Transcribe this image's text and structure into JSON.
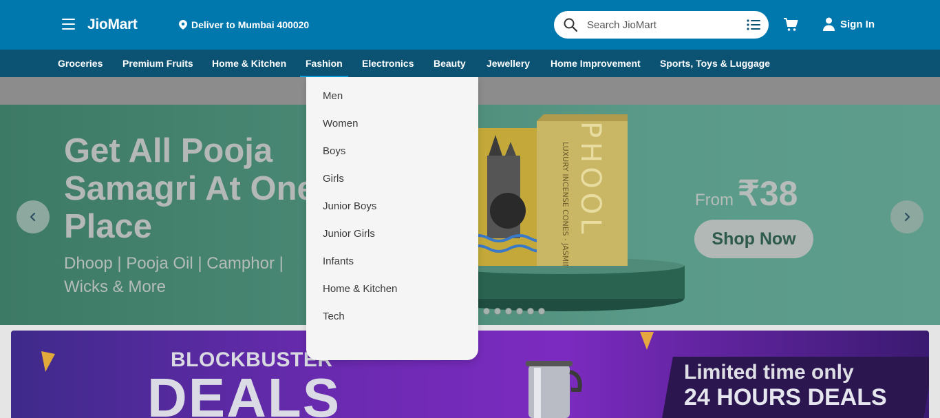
{
  "header": {
    "logo": "JioMart",
    "deliver": "Deliver to Mumbai 400020",
    "search_placeholder": "Search JioMart",
    "signin": "Sign In"
  },
  "nav": {
    "items": [
      {
        "label": "Groceries"
      },
      {
        "label": "Premium Fruits"
      },
      {
        "label": "Home & Kitchen"
      },
      {
        "label": "Fashion",
        "active": true
      },
      {
        "label": "Electronics"
      },
      {
        "label": "Beauty"
      },
      {
        "label": "Jewellery"
      },
      {
        "label": "Home Improvement"
      },
      {
        "label": "Sports, Toys & Luggage"
      }
    ]
  },
  "dropdown": {
    "items": [
      "Men",
      "Women",
      "Boys",
      "Girls",
      "Junior Boys",
      "Junior Girls",
      "Infants",
      "Home & Kitchen",
      "Tech"
    ]
  },
  "banner": {
    "title": "Get All Pooja Samagri At One Place",
    "subtitle": "Dhoop | Pooja Oil | Camphor | Wicks & More",
    "from": "From",
    "price": "₹38",
    "cta": "Shop Now",
    "product_brand": "PHOOL",
    "product_text": "LUXURY INCENSE CONES · JASMINE",
    "slide_count": 6
  },
  "deals": {
    "title": "BLOCKBUSTER",
    "big": "DEALS",
    "limited": "Limited time only",
    "hours": "24 HOURS DEALS"
  },
  "colors": {
    "header": "#0078ad",
    "nav": "#0c5273",
    "banner": "#4b8a76"
  }
}
